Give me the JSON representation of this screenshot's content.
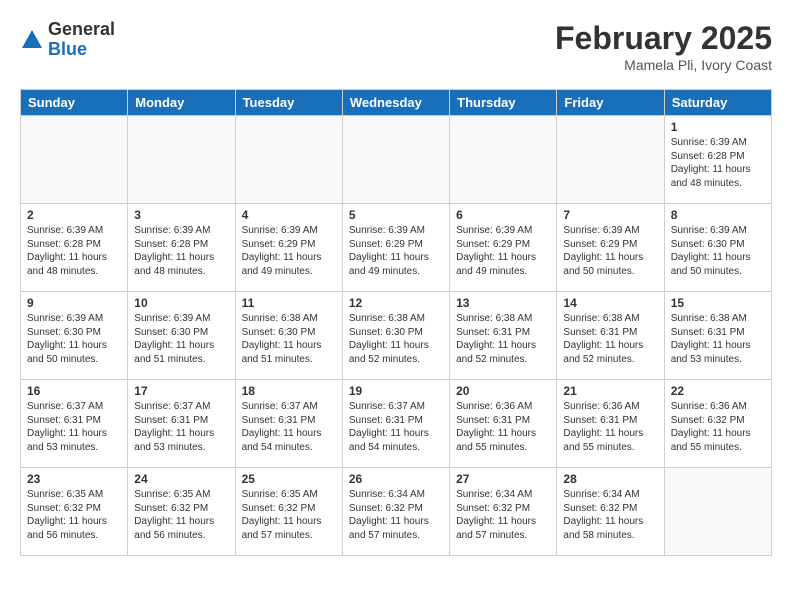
{
  "logo": {
    "general": "General",
    "blue": "Blue"
  },
  "title": "February 2025",
  "location": "Mamela Pli, Ivory Coast",
  "days_of_week": [
    "Sunday",
    "Monday",
    "Tuesday",
    "Wednesday",
    "Thursday",
    "Friday",
    "Saturday"
  ],
  "weeks": [
    [
      {
        "day": "",
        "info": ""
      },
      {
        "day": "",
        "info": ""
      },
      {
        "day": "",
        "info": ""
      },
      {
        "day": "",
        "info": ""
      },
      {
        "day": "",
        "info": ""
      },
      {
        "day": "",
        "info": ""
      },
      {
        "day": "1",
        "info": "Sunrise: 6:39 AM\nSunset: 6:28 PM\nDaylight: 11 hours\nand 48 minutes."
      }
    ],
    [
      {
        "day": "2",
        "info": "Sunrise: 6:39 AM\nSunset: 6:28 PM\nDaylight: 11 hours\nand 48 minutes."
      },
      {
        "day": "3",
        "info": "Sunrise: 6:39 AM\nSunset: 6:28 PM\nDaylight: 11 hours\nand 48 minutes."
      },
      {
        "day": "4",
        "info": "Sunrise: 6:39 AM\nSunset: 6:29 PM\nDaylight: 11 hours\nand 49 minutes."
      },
      {
        "day": "5",
        "info": "Sunrise: 6:39 AM\nSunset: 6:29 PM\nDaylight: 11 hours\nand 49 minutes."
      },
      {
        "day": "6",
        "info": "Sunrise: 6:39 AM\nSunset: 6:29 PM\nDaylight: 11 hours\nand 49 minutes."
      },
      {
        "day": "7",
        "info": "Sunrise: 6:39 AM\nSunset: 6:29 PM\nDaylight: 11 hours\nand 50 minutes."
      },
      {
        "day": "8",
        "info": "Sunrise: 6:39 AM\nSunset: 6:30 PM\nDaylight: 11 hours\nand 50 minutes."
      }
    ],
    [
      {
        "day": "9",
        "info": "Sunrise: 6:39 AM\nSunset: 6:30 PM\nDaylight: 11 hours\nand 50 minutes."
      },
      {
        "day": "10",
        "info": "Sunrise: 6:39 AM\nSunset: 6:30 PM\nDaylight: 11 hours\nand 51 minutes."
      },
      {
        "day": "11",
        "info": "Sunrise: 6:38 AM\nSunset: 6:30 PM\nDaylight: 11 hours\nand 51 minutes."
      },
      {
        "day": "12",
        "info": "Sunrise: 6:38 AM\nSunset: 6:30 PM\nDaylight: 11 hours\nand 52 minutes."
      },
      {
        "day": "13",
        "info": "Sunrise: 6:38 AM\nSunset: 6:31 PM\nDaylight: 11 hours\nand 52 minutes."
      },
      {
        "day": "14",
        "info": "Sunrise: 6:38 AM\nSunset: 6:31 PM\nDaylight: 11 hours\nand 52 minutes."
      },
      {
        "day": "15",
        "info": "Sunrise: 6:38 AM\nSunset: 6:31 PM\nDaylight: 11 hours\nand 53 minutes."
      }
    ],
    [
      {
        "day": "16",
        "info": "Sunrise: 6:37 AM\nSunset: 6:31 PM\nDaylight: 11 hours\nand 53 minutes."
      },
      {
        "day": "17",
        "info": "Sunrise: 6:37 AM\nSunset: 6:31 PM\nDaylight: 11 hours\nand 53 minutes."
      },
      {
        "day": "18",
        "info": "Sunrise: 6:37 AM\nSunset: 6:31 PM\nDaylight: 11 hours\nand 54 minutes."
      },
      {
        "day": "19",
        "info": "Sunrise: 6:37 AM\nSunset: 6:31 PM\nDaylight: 11 hours\nand 54 minutes."
      },
      {
        "day": "20",
        "info": "Sunrise: 6:36 AM\nSunset: 6:31 PM\nDaylight: 11 hours\nand 55 minutes."
      },
      {
        "day": "21",
        "info": "Sunrise: 6:36 AM\nSunset: 6:31 PM\nDaylight: 11 hours\nand 55 minutes."
      },
      {
        "day": "22",
        "info": "Sunrise: 6:36 AM\nSunset: 6:32 PM\nDaylight: 11 hours\nand 55 minutes."
      }
    ],
    [
      {
        "day": "23",
        "info": "Sunrise: 6:35 AM\nSunset: 6:32 PM\nDaylight: 11 hours\nand 56 minutes."
      },
      {
        "day": "24",
        "info": "Sunrise: 6:35 AM\nSunset: 6:32 PM\nDaylight: 11 hours\nand 56 minutes."
      },
      {
        "day": "25",
        "info": "Sunrise: 6:35 AM\nSunset: 6:32 PM\nDaylight: 11 hours\nand 57 minutes."
      },
      {
        "day": "26",
        "info": "Sunrise: 6:34 AM\nSunset: 6:32 PM\nDaylight: 11 hours\nand 57 minutes."
      },
      {
        "day": "27",
        "info": "Sunrise: 6:34 AM\nSunset: 6:32 PM\nDaylight: 11 hours\nand 57 minutes."
      },
      {
        "day": "28",
        "info": "Sunrise: 6:34 AM\nSunset: 6:32 PM\nDaylight: 11 hours\nand 58 minutes."
      },
      {
        "day": "",
        "info": ""
      }
    ]
  ]
}
